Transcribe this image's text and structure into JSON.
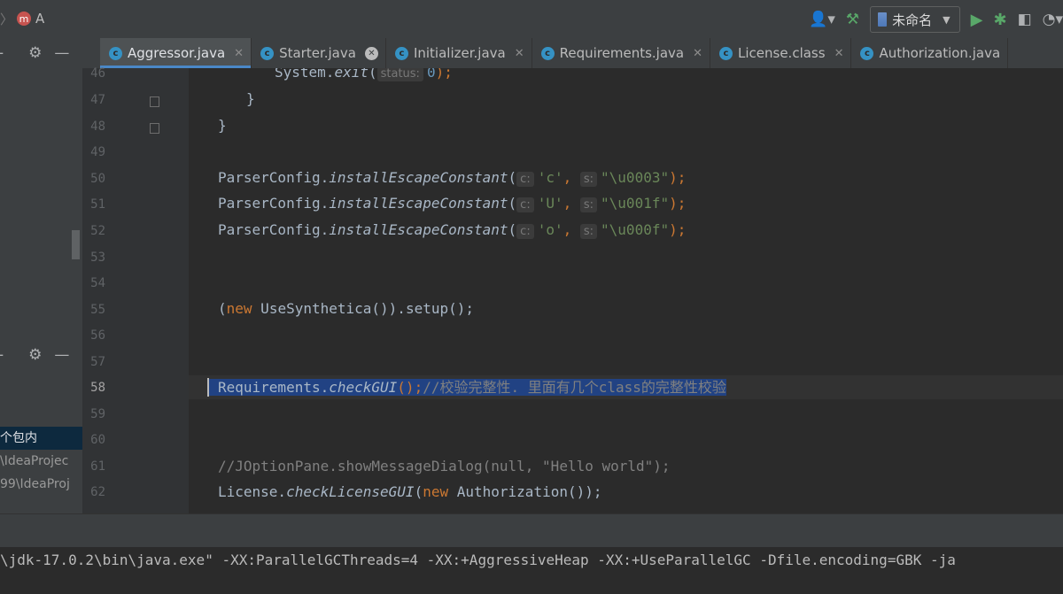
{
  "toolbar": {
    "breadcrumb_sep": "〉",
    "module_icon": "m",
    "project_label": "A",
    "run_config_label": "未命名",
    "icons": [
      "user-icon",
      "build-hammer-icon",
      "run-icon",
      "debug-icon",
      "coverage-icon",
      "profile-icon"
    ]
  },
  "left_panel": {
    "rows": [
      {
        "text": "个包内",
        "selected": true
      },
      {
        "text": "\\IdeaProjec",
        "selected": false
      },
      {
        "text": "99\\IdeaProj",
        "selected": false
      }
    ]
  },
  "tabs": [
    {
      "label": "Aggressor.java",
      "active": true
    },
    {
      "label": "Starter.java",
      "active": false
    },
    {
      "label": "Initializer.java",
      "active": false
    },
    {
      "label": "Requirements.java",
      "active": false
    },
    {
      "label": "License.class",
      "active": false
    },
    {
      "label": "Authorization.java",
      "active": false
    }
  ],
  "code": {
    "line_numbers": [
      "46",
      "47",
      "48",
      "49",
      "50",
      "51",
      "52",
      "53",
      "54",
      "55",
      "56",
      "57",
      "58",
      "59",
      "60",
      "61",
      "62"
    ],
    "current_line": "58",
    "lines": {
      "l46_a": "System.",
      "l46_b": "exit",
      "l46_c": "(",
      "l46_hint": "status:",
      "l46_num": "0",
      "l46_d": ");",
      "l47": "}",
      "l48": "}",
      "l50_cls": "ParserConfig.",
      "l50_m": "installEscapeConstant",
      "l50_p": "(",
      "hint_c": "c:",
      "hint_s": "s:",
      "l50_ch": "'c'",
      "l50_str": "\"\\u0003\"",
      "l51_ch": "'U'",
      "l51_str": "\"\\u001f\"",
      "l52_ch": "'o'",
      "l52_str": "\"\\u000f\"",
      "comma": ", ",
      "close": ");",
      "l55_open": "(",
      "l55_new": "new",
      "l55_rest": " UseSynthetica()).setup();",
      "l58_cls": "Requirements.",
      "l58_m": "checkGUI",
      "l58_rest": "();",
      "l58_comment": "//校验完整性. 里面有几个class的完整性校验",
      "l61_comment": "//JOptionPane.showMessageDialog(null, \"Hello world\");",
      "l62_cls": "License.",
      "l62_m": "checkLicenseGUI",
      "l62_p": "(",
      "l62_new": "new",
      "l62_rest": " Authorization());"
    }
  },
  "console": {
    "command": "\\jdk-17.0.2\\bin\\java.exe\" -XX:ParallelGCThreads=4 -XX:+AggressiveHeap -XX:+UseParallelGC -Dfile.encoding=GBK -ja"
  }
}
